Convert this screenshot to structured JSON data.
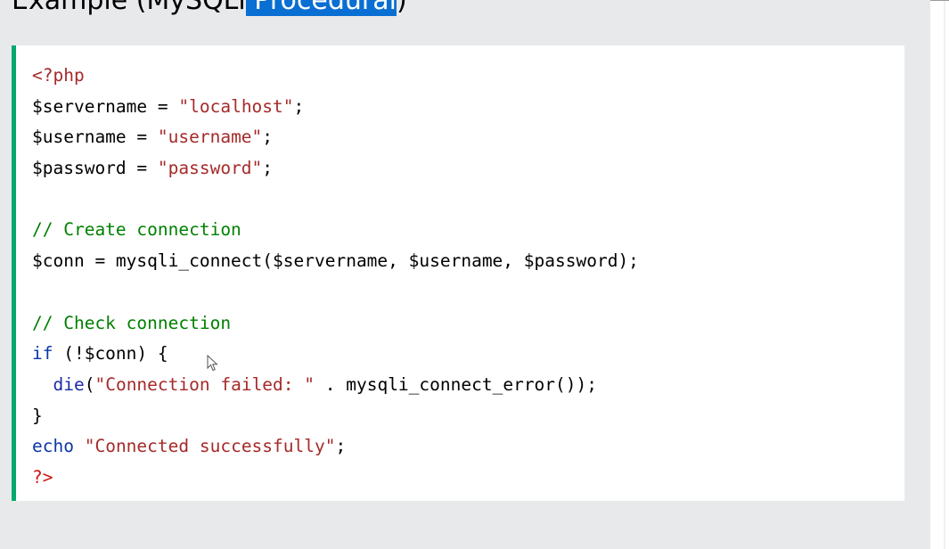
{
  "heading": {
    "prefix": "Example (MySQLi",
    "selected": " Procedural",
    "suffix": ")"
  },
  "code": {
    "lines": [
      {
        "parts": [
          {
            "t": "<?php",
            "k": "tag"
          }
        ]
      },
      {
        "parts": [
          {
            "t": "$servername = ",
            "k": "plain"
          },
          {
            "t": "\"localhost\"",
            "k": "str"
          },
          {
            "t": ";",
            "k": "plain"
          }
        ]
      },
      {
        "parts": [
          {
            "t": "$username = ",
            "k": "plain"
          },
          {
            "t": "\"username\"",
            "k": "str"
          },
          {
            "t": ";",
            "k": "plain"
          }
        ]
      },
      {
        "parts": [
          {
            "t": "$password = ",
            "k": "plain"
          },
          {
            "t": "\"password\"",
            "k": "str"
          },
          {
            "t": ";",
            "k": "plain"
          }
        ]
      },
      {
        "parts": []
      },
      {
        "parts": [
          {
            "t": "// Create connection",
            "k": "com"
          }
        ]
      },
      {
        "parts": [
          {
            "t": "$conn = mysqli_connect($servername, $username, $password);",
            "k": "plain"
          }
        ]
      },
      {
        "parts": []
      },
      {
        "parts": [
          {
            "t": "// Check connection",
            "k": "com"
          }
        ]
      },
      {
        "parts": [
          {
            "t": "if",
            "k": "kw"
          },
          {
            "t": " (!$conn) {",
            "k": "plain"
          }
        ]
      },
      {
        "parts": [
          {
            "t": "  ",
            "k": "plain"
          },
          {
            "t": "die",
            "k": "fn"
          },
          {
            "t": "(",
            "k": "plain"
          },
          {
            "t": "\"Connection failed: \"",
            "k": "str"
          },
          {
            "t": " . mysqli_connect_error());",
            "k": "plain"
          }
        ]
      },
      {
        "parts": [
          {
            "t": "}",
            "k": "plain"
          }
        ]
      },
      {
        "parts": [
          {
            "t": "echo",
            "k": "kw"
          },
          {
            "t": " ",
            "k": "plain"
          },
          {
            "t": "\"Connected successfully\"",
            "k": "str"
          },
          {
            "t": ";",
            "k": "plain"
          }
        ]
      },
      {
        "parts": [
          {
            "t": "?>",
            "k": "tagred"
          }
        ]
      }
    ]
  },
  "icons": {
    "cursor": "mouse-pointer-icon"
  },
  "colors": {
    "accent_border": "#04aa6d",
    "selection": "#0a6fd2",
    "string": "#a52a2a",
    "comment": "#008000",
    "keyword": "#0b36a8"
  }
}
